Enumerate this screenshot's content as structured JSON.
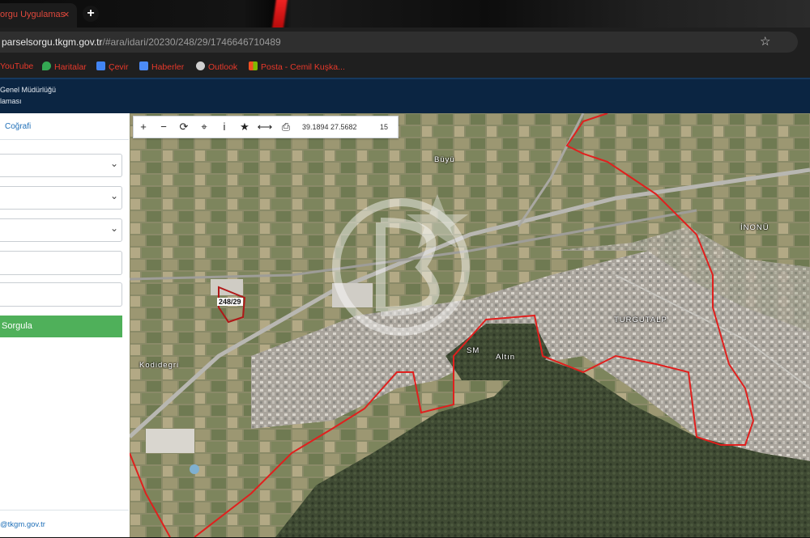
{
  "browser": {
    "tab_title": "orgu Uygulamas",
    "tab_close": "×",
    "new_tab": "+",
    "url_host": "parselsorgu.tkgm.gov.tr",
    "url_path": "/#ara/idari/20230/248/29/1746646710489",
    "star_icon": "star-icon",
    "bookmarks": [
      {
        "label": "YouTube",
        "icon": "youtube-icon",
        "color": "#ff0000"
      },
      {
        "label": "Haritalar",
        "icon": "maps-icon",
        "color": "#34a853"
      },
      {
        "label": "Çevir",
        "icon": "translate-icon",
        "color": "#4285f4"
      },
      {
        "label": "Haberler",
        "icon": "news-icon",
        "color": "#4c8bf5"
      },
      {
        "label": "Outlook",
        "icon": "outlook-icon",
        "color": "#cfcfcf"
      },
      {
        "label": "Posta - Cemil Kuşka...",
        "icon": "microsoft-icon",
        "color": "#f25022"
      }
    ]
  },
  "app": {
    "title_line1": "Genel Müdürlüğü",
    "title_line2": "laması"
  },
  "sidebar": {
    "tab_label": "Coğrafi",
    "query_button": "Sorgula",
    "footer_email": "@tkgm.gov.tr"
  },
  "map": {
    "tools": [
      {
        "glyph": "+",
        "icon": "zoom-in-icon"
      },
      {
        "glyph": "−",
        "icon": "zoom-out-icon"
      },
      {
        "glyph": "⟳",
        "icon": "refresh-icon"
      },
      {
        "glyph": "⌖",
        "icon": "locate-icon"
      },
      {
        "glyph": "i",
        "icon": "info-icon"
      },
      {
        "glyph": "★",
        "icon": "favorite-icon"
      },
      {
        "glyph": "⟷",
        "icon": "measure-icon"
      },
      {
        "glyph": "⎙",
        "icon": "print-icon"
      }
    ],
    "coordinates": "39.1894   27.5682",
    "zoom": "15",
    "parcel_label": "248/29",
    "labels": {
      "inonu": "İNONÜ",
      "turgutalp": "TURGUTALP",
      "altin": "Altın",
      "sm": "SM",
      "kodidegri": "Kodidegri",
      "buyuk": "Büyü"
    }
  },
  "colors": {
    "boundary": "#e0201e",
    "header_bg": "#0b2542",
    "query_green": "#4fb05a",
    "link_blue": "#1e6fb8"
  }
}
